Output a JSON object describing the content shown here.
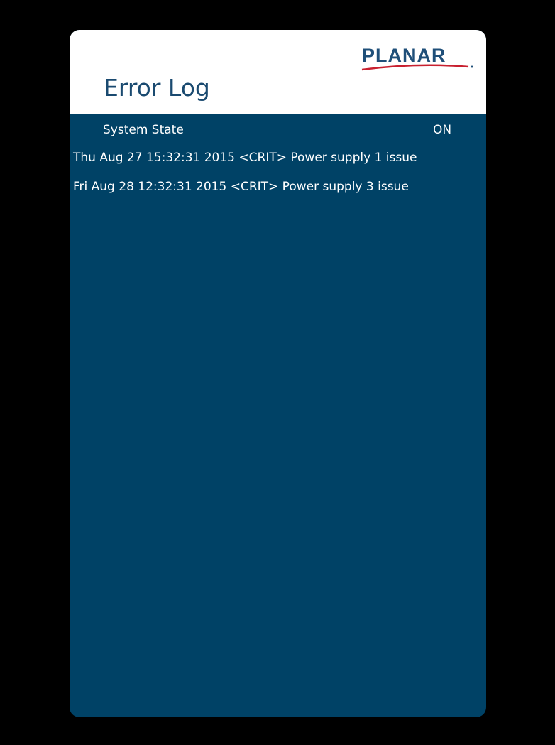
{
  "brand": {
    "logo_text": "PLANAR",
    "logo_colors": {
      "text": "#1f4f79",
      "swoosh": "#c8202f"
    }
  },
  "page": {
    "title": "Error Log"
  },
  "system_state": {
    "label": "System State",
    "value": "ON"
  },
  "log_entries": [
    {
      "text": "Thu Aug 27 15:32:31 2015 <CRIT> Power supply 1 issue"
    },
    {
      "text": "Fri Aug 28 12:32:31 2015 <CRIT> Power supply 3 issue"
    }
  ],
  "colors": {
    "background": "#000000",
    "panel": "#004266",
    "header": "#ffffff",
    "title": "#1a4a70",
    "text": "#ffffff"
  }
}
